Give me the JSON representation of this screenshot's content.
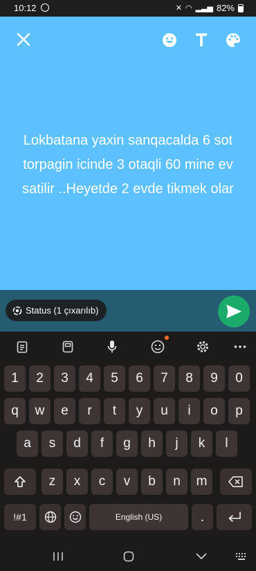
{
  "status_bar": {
    "time": "10:12",
    "battery": "82%"
  },
  "editor": {
    "background": "#5cc1fe",
    "status_text": "Lokbatana yaxin sanqacalda 6 sot torpagin icinde 3 otaqli 60 mine ev satilir ..Heyetde 2 evde tikmek olar"
  },
  "compose": {
    "audience_label": "Status (1 çıxarılıb)",
    "send_color": "#1aab6b"
  },
  "keyboard": {
    "toolbar": [
      "clipboard-icon",
      "sticker-icon",
      "mic-icon",
      "emoji-icon",
      "settings-icon",
      "more-icon"
    ],
    "row_numbers": [
      "1",
      "2",
      "3",
      "4",
      "5",
      "6",
      "7",
      "8",
      "9",
      "0"
    ],
    "row_top": [
      "q",
      "w",
      "e",
      "r",
      "t",
      "y",
      "u",
      "i",
      "o",
      "p"
    ],
    "row_middle": [
      "a",
      "s",
      "d",
      "f",
      "g",
      "h",
      "j",
      "k",
      "l"
    ],
    "row_bottom": [
      "z",
      "x",
      "c",
      "v",
      "b",
      "n",
      "m"
    ],
    "symbols_key": "!#1",
    "space_label": "English (US)",
    "period_key": "."
  }
}
